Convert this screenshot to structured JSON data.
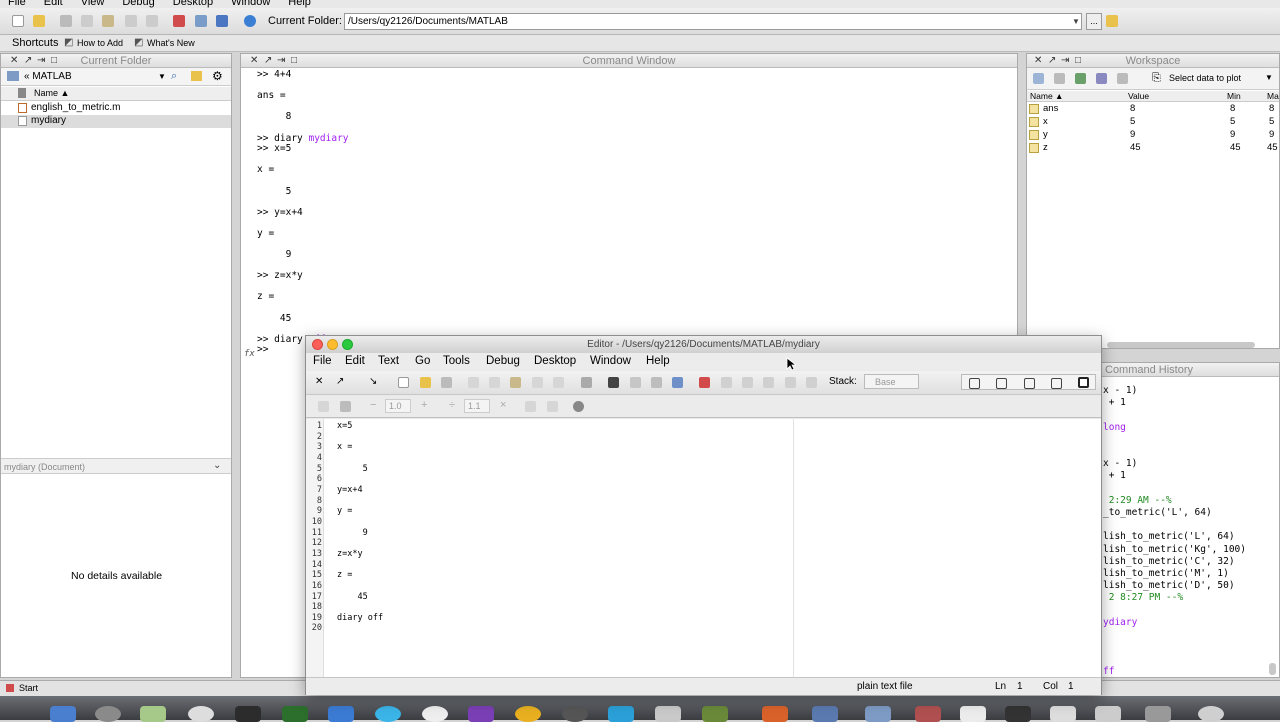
{
  "menubar": [
    "File",
    "Edit",
    "View",
    "Debug",
    "Desktop",
    "Window",
    "Help"
  ],
  "toolbar": {
    "current_folder_label": "Current Folder:",
    "current_folder_path": "/Users/qy2126/Documents/MATLAB",
    "browse_label": "..."
  },
  "shortcuts": {
    "label": "Shortcuts",
    "how_to_add": "How to Add",
    "whats_new": "What's New"
  },
  "current_folder": {
    "title": "Current Folder",
    "path": "« MATLAB",
    "column_name": "Name ▲",
    "files": [
      "english_to_metric.m",
      "mydiary"
    ],
    "details_title": "mydiary (Document)",
    "details_text": "No details available"
  },
  "command_window": {
    "title": "Command Window",
    "lines": [
      ">> 4+4",
      "",
      "ans =",
      "",
      "     8",
      "",
      ">> diary mydiary",
      ">> x=5",
      "",
      "x =",
      "",
      "     5",
      "",
      ">> y=x+4",
      "",
      "y =",
      "",
      "     9",
      "",
      ">> z=x*y",
      "",
      "z =",
      "",
      "    45",
      "",
      ">> diary off",
      ">> "
    ]
  },
  "workspace": {
    "title": "Workspace",
    "select_plot": "Select data to plot",
    "columns": [
      "Name ▲",
      "Value",
      "Min",
      "Ma"
    ],
    "rows": [
      {
        "name": "ans",
        "value": "8",
        "min": "8",
        "max": "8"
      },
      {
        "name": "x",
        "value": "5",
        "min": "5",
        "max": "5"
      },
      {
        "name": "y",
        "value": "9",
        "min": "9",
        "max": "9"
      },
      {
        "name": "z",
        "value": "45",
        "min": "45",
        "max": "45"
      }
    ]
  },
  "history": {
    "title": "Command History",
    "lines": [
      {
        "t": "x - 1)",
        "c": ""
      },
      {
        "t": " + 1",
        "c": ""
      },
      {
        "t": "",
        "c": ""
      },
      {
        "t": "long",
        "c": "purple"
      },
      {
        "t": "",
        "c": ""
      },
      {
        "t": "",
        "c": ""
      },
      {
        "t": "x - 1)",
        "c": ""
      },
      {
        "t": " + 1",
        "c": ""
      },
      {
        "t": "",
        "c": ""
      },
      {
        "t": " 2:29 AM --%",
        "c": "green"
      },
      {
        "t": "_to_metric('L', 64)",
        "c": ""
      },
      {
        "t": "",
        "c": ""
      },
      {
        "t": "lish_to_metric('L', 64)",
        "c": ""
      },
      {
        "t": "lish_to_metric('Kg', 100)",
        "c": ""
      },
      {
        "t": "lish_to_metric('C', 32)",
        "c": ""
      },
      {
        "t": "lish_to_metric('M', 1)",
        "c": ""
      },
      {
        "t": "lish_to_metric('D', 50)",
        "c": ""
      },
      {
        "t": " 2 8:27 PM --%",
        "c": "green"
      },
      {
        "t": "",
        "c": ""
      },
      {
        "t": "ydiary",
        "c": "purple"
      },
      {
        "t": "",
        "c": ""
      },
      {
        "t": "",
        "c": ""
      },
      {
        "t": "",
        "c": ""
      },
      {
        "t": "ff",
        "c": "purple"
      }
    ]
  },
  "start_label": "Start",
  "editor": {
    "title": "Editor - /Users/qy2126/Documents/MATLAB/mydiary",
    "menu": [
      "File",
      "Edit",
      "Text",
      "Go",
      "Tools",
      "Debug",
      "Desktop",
      "Window",
      "Help"
    ],
    "stack_label": "Stack:",
    "stack_value": "Base",
    "cell_value_1": "1.0",
    "cell_value_2": "1.1",
    "line_numbers": [
      "1",
      "2",
      "3",
      "4",
      "5",
      "6",
      "7",
      "8",
      "9",
      "10",
      "11",
      "12",
      "13",
      "14",
      "15",
      "16",
      "17",
      "18",
      "19",
      "20"
    ],
    "code": [
      "x=5",
      "",
      "x =",
      "",
      "     5",
      "",
      "y=x+4",
      "",
      "y =",
      "",
      "     9",
      "",
      "z=x*y",
      "",
      "z =",
      "",
      "    45",
      "",
      "diary off",
      ""
    ],
    "status_type": "plain text file",
    "status_ln_label": "Ln",
    "status_ln": "1",
    "status_col_label": "Col",
    "status_col": "1"
  }
}
